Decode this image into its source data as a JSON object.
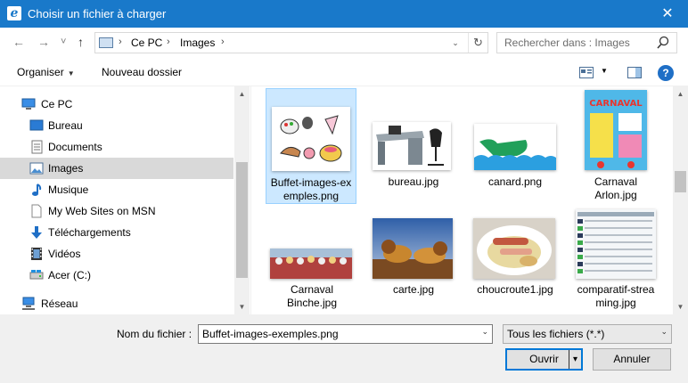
{
  "window": {
    "title": "Choisir un fichier à charger",
    "close_glyph": "✕",
    "app_icon": "e"
  },
  "nav": {
    "back_glyph": "←",
    "forward_glyph": "→",
    "recent_glyph": "˅",
    "up_glyph": "↑",
    "breadcrumb": [
      "Ce PC",
      "Images"
    ],
    "breadcrumb_sep": "›",
    "dropdown_glyph": "⌄",
    "refresh_glyph": "↻",
    "search_placeholder": "Rechercher dans : Images"
  },
  "toolbar": {
    "organize_label": "Organiser",
    "new_folder_label": "Nouveau dossier",
    "caret": "▼",
    "help_glyph": "?"
  },
  "sidebar": {
    "items": [
      {
        "label": "Ce PC",
        "icon": "pc-icon",
        "selected": false
      },
      {
        "label": "Bureau",
        "icon": "desktop-icon",
        "selected": false
      },
      {
        "label": "Documents",
        "icon": "documents-icon",
        "selected": false
      },
      {
        "label": "Images",
        "icon": "images-icon",
        "selected": true
      },
      {
        "label": "Musique",
        "icon": "music-icon",
        "selected": false
      },
      {
        "label": "My Web Sites on MSN",
        "icon": "web-page-icon",
        "selected": false
      },
      {
        "label": "Téléchargements",
        "icon": "download-icon",
        "selected": false
      },
      {
        "label": "Vidéos",
        "icon": "video-icon",
        "selected": false
      },
      {
        "label": "Acer (C:)",
        "icon": "drive-icon",
        "selected": false
      },
      {
        "label": "Réseau",
        "icon": "network-icon",
        "selected": false
      }
    ],
    "scroll_up": "▲",
    "scroll_down": "▼"
  },
  "files": [
    {
      "name": "Buffet-images-exemples.png",
      "line1": "Buffet-images-ex",
      "line2": "emples.png",
      "selected": true,
      "icon": "clipart-buffet-thumbnail"
    },
    {
      "name": "bureau.jpg",
      "line1": "bureau.jpg",
      "line2": "",
      "selected": false,
      "icon": "desk-photo-thumbnail"
    },
    {
      "name": "canard.png",
      "line1": "canard.png",
      "line2": "",
      "selected": false,
      "icon": "duck-drawing-thumbnail"
    },
    {
      "name": "Carnaval Arlon.jpg",
      "line1": "Carnaval",
      "line2": "Arlon.jpg",
      "selected": false,
      "icon": "poster-thumbnail"
    },
    {
      "name": "Carnaval Binche.jpg",
      "line1": "Carnaval",
      "line2": "Binche.jpg",
      "selected": false,
      "icon": "crowd-photo-thumbnail"
    },
    {
      "name": "carte.jpg",
      "line1": "carte.jpg",
      "line2": "",
      "selected": false,
      "icon": "lions-photo-thumbnail"
    },
    {
      "name": "choucroute1.jpg",
      "line1": "choucroute1.jpg",
      "line2": "",
      "selected": false,
      "icon": "food-photo-thumbnail"
    },
    {
      "name": "comparatif-streaming.jpg",
      "line1": "comparatif-strea",
      "line2": "ming.jpg",
      "selected": false,
      "icon": "table-screenshot-thumbnail"
    }
  ],
  "bottom": {
    "filename_label": "Nom du fichier :",
    "filename_value": "Buffet-images-exemples.png",
    "filter_value": "Tous les fichiers (*.*)",
    "open_label": "Ouvrir",
    "cancel_label": "Annuler",
    "combo_arrow": "⌄",
    "split_arrow": "▾"
  },
  "colors": {
    "titlebar": "#1979ca",
    "selection": "#cce8ff",
    "accent": "#0078d7"
  }
}
